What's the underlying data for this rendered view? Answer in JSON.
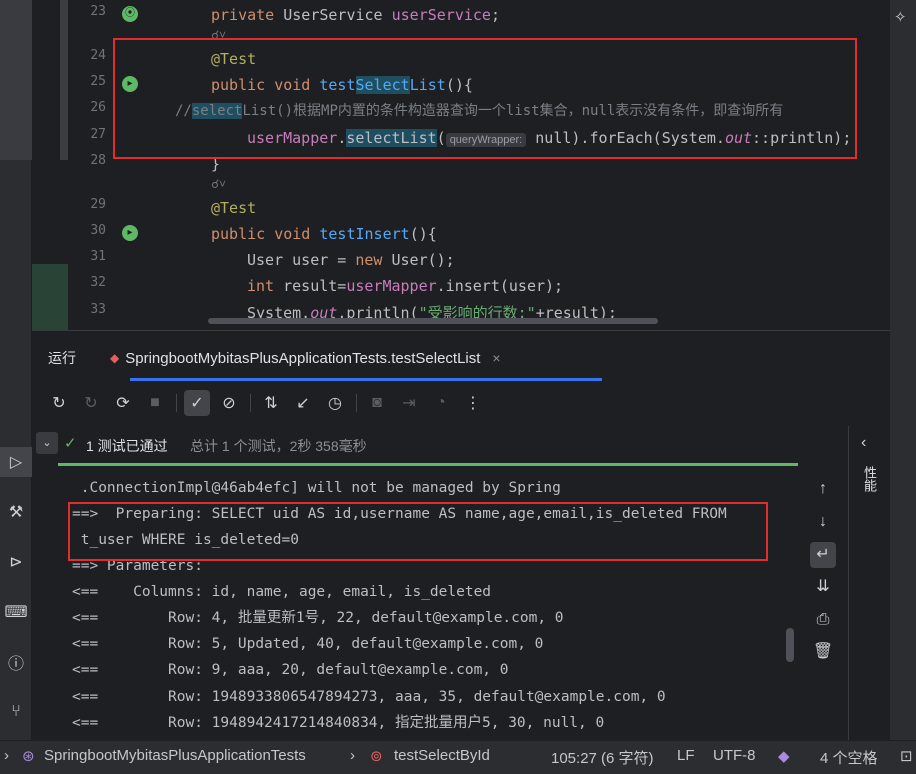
{
  "editor": {
    "line_numbers": [
      "23",
      "24",
      "25",
      "26",
      "27",
      "28",
      "29",
      "30",
      "31",
      "32",
      "33"
    ],
    "lines": {
      "l23": {
        "p1": "private ",
        "p2": "UserService ",
        "p3": "userService",
        "p4": ";"
      },
      "l24": {
        "text": "@Test"
      },
      "l25": {
        "p1": "public void ",
        "p2": "test",
        "p3": "Select",
        "p4": "List",
        "p5": "(){"
      },
      "l26": {
        "p1": "//",
        "p2": "select",
        "p3": "List()根据MP内置的条件构造器查询一个list集合，null表示没有条件，即查询所有"
      },
      "l27": {
        "p1": "userMapper",
        "p2": ".",
        "p3": "selectList",
        "p4": "(",
        "hint": "queryWrapper:",
        "p5": " null).forEach(System.",
        "p6": "out",
        "p7": "::println);"
      },
      "l28": {
        "text": "}"
      },
      "l29": {
        "text": "@Test"
      },
      "l30": {
        "p1": "public void ",
        "p2": "testInsert",
        "p3": "(){"
      },
      "l31": {
        "p1": "User user = ",
        "p2": "new ",
        "p3": "User();"
      },
      "l32": {
        "p1": "int ",
        "p2": "result=",
        "p3": "userMapper",
        "p4": ".insert(user);"
      },
      "l33": {
        "p1": "System.",
        "p2": "out",
        "p3": ".println(",
        "p4": "\"受影响的行数:\"",
        "p5": "+result);"
      }
    }
  },
  "run_panel": {
    "title": "运行",
    "tab_label": "SpringbootMybitasPlusApplicationTests.testSelectList",
    "tab_close": "×",
    "status_pass": "1 测试已通过",
    "status_summary": "总计 1 个测试，2秒 358毫秒",
    "console_lines": [
      " .ConnectionImpl@46ab4efc] will not be managed by Spring",
      "==>  Preparing: SELECT uid AS id,username AS name,age,email,is_deleted FROM",
      " t_user WHERE is_deleted=0",
      "==> Parameters: ",
      "<==    Columns: id, name, age, email, is_deleted",
      "<==        Row: 4, 批量更新1号, 22, default@example.com, 0",
      "<==        Row: 5, Updated, 40, default@example.com, 0",
      "<==        Row: 9, aaa, 20, default@example.com, 0",
      "<==        Row: 1948933806547894273, aaa, 35, default@example.com, 0",
      "<==        Row: 1948942417214840834, 指定批量用户5, 30, null, 0"
    ],
    "side_label": "性能"
  },
  "status_bar": {
    "breadcrumb_class": "SpringbootMybitasPlusApplicationTests",
    "breadcrumb_method": "testSelectById",
    "position": "105:27 (6 字符)",
    "line_sep": "LF",
    "encoding": "UTF-8",
    "indent": "4 个空格"
  },
  "icons": {
    "rerun": "rerun-icon",
    "rerun_failed": "rerun-failed-icon",
    "toggle_auto": "toggle-auto-test-icon",
    "stop": "stop-icon",
    "show_passed": "check-icon",
    "show_ignored": "ignored-icon",
    "sort": "sort-icon",
    "import": "import-results-icon",
    "history": "history-icon",
    "scroll_up": "arrow-up-icon",
    "scroll_down": "arrow-down-icon",
    "soft_wrap": "soft-wrap-icon",
    "scroll_end": "scroll-to-end-icon",
    "print": "print-icon",
    "trash": "trash-icon"
  },
  "colors": {
    "accent": "#3574f0",
    "pass": "#5fb865",
    "highlight_box": "#e12d2d",
    "background": "#1e1f22"
  }
}
